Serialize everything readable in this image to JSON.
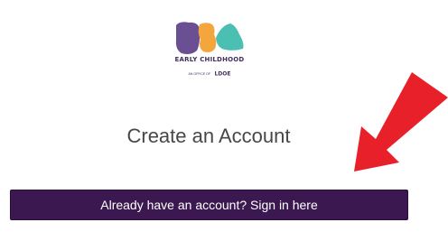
{
  "logo": {
    "title": "EARLY CHILDHOOD",
    "subtitle_small": "AN OFFICE OF",
    "subtitle_brand": "LDOE"
  },
  "heading": "Create an Account",
  "signin_button": {
    "label": "Already have an account? Sign in here"
  },
  "colors": {
    "button_bg": "#3b1850",
    "arrow": "#e8202a",
    "logo_purple": "#6b4f93",
    "logo_orange": "#f4a53c",
    "logo_teal": "#4bbfb2"
  }
}
